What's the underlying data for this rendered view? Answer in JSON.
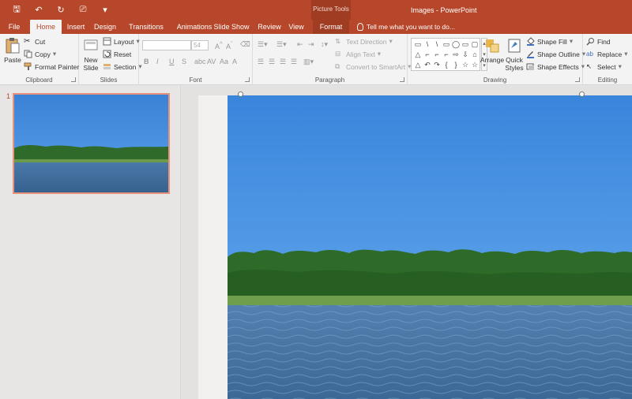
{
  "titlebar": {
    "window_title": "Images - PowerPoint",
    "contextual_group": "Picture Tools",
    "qat": [
      {
        "icon": "save-icon",
        "glyph": "🖫"
      },
      {
        "icon": "undo-icon",
        "glyph": "↶"
      },
      {
        "icon": "redo-icon",
        "glyph": "↻"
      },
      {
        "icon": "presentation-icon",
        "glyph": "⎚"
      },
      {
        "icon": "customize-qat-icon",
        "glyph": "▾"
      }
    ]
  },
  "tabs": [
    "File",
    "Home",
    "Insert",
    "Design",
    "Transitions",
    "Animations",
    "Slide Show",
    "Review",
    "View",
    "Format"
  ],
  "active_tab": "Home",
  "tell_me": "Tell me what you want to do...",
  "ribbon": {
    "clipboard": {
      "label": "Clipboard",
      "paste": "Paste",
      "cut": "Cut",
      "copy": "Copy",
      "format_painter": "Format Painter"
    },
    "slides": {
      "label": "Slides",
      "new_slide": "New",
      "new_slide_2": "Slide",
      "layout": "Layout",
      "reset": "Reset",
      "section": "Section"
    },
    "font": {
      "label": "Font",
      "font_name": "",
      "font_size": "54",
      "buttons": [
        "B",
        "I",
        "U",
        "S",
        "abc",
        "AV",
        "Aa",
        "A"
      ]
    },
    "paragraph": {
      "label": "Paragraph",
      "text_direction": "Text Direction",
      "align_text": "Align Text",
      "convert_smartart": "Convert to SmartArt"
    },
    "drawing": {
      "label": "Drawing",
      "shapes": [
        "▭",
        "\\",
        "\\",
        "▭",
        "◯",
        "▭",
        "▢",
        "△",
        "⌐",
        "⌐",
        "⌐",
        "⇨",
        "⇩",
        "⌂",
        "△",
        "↶",
        "↷",
        "{",
        "}",
        "☆",
        "☆"
      ],
      "arrange": "Arrange",
      "quick_styles": "Quick",
      "quick_styles_2": "Styles",
      "shape_fill": "Shape Fill",
      "shape_outline": "Shape Outline",
      "shape_effects": "Shape Effects"
    },
    "editing": {
      "label": "Editing",
      "find": "Find",
      "replace": "Replace",
      "select": "Select"
    }
  },
  "slides_panel": {
    "slide_number": "1"
  },
  "colors": {
    "accent": "#b7472a",
    "thumb_border": "#e8927c"
  }
}
